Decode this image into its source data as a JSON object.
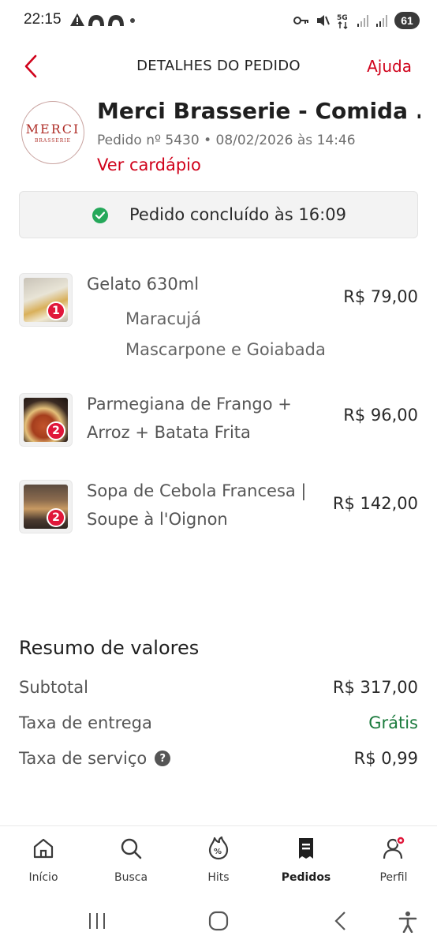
{
  "status_bar": {
    "time": "22:15",
    "battery": "61",
    "network": "5G"
  },
  "header": {
    "title": "DETALHES DO PEDIDO",
    "help": "Ajuda"
  },
  "restaurant": {
    "logo_text": "MERCI",
    "logo_subtext": "BRASSERIE",
    "name": "Merci Brasserie - Comida ...",
    "order_meta": "Pedido nº 5430 • 08/02/2026 às 14:46",
    "menu_link": "Ver cardápio"
  },
  "order_status": {
    "text": "Pedido concluído às 16:09"
  },
  "items": [
    {
      "qty": "1",
      "name": "Gelato 630ml",
      "price": "R$ 79,00",
      "options": [
        "Maracujá",
        "Mascarpone e Goiabada"
      ]
    },
    {
      "qty": "2",
      "name": "Parmegiana de Frango + Arroz + Batata Frita",
      "price": "R$ 96,00",
      "options": []
    },
    {
      "qty": "2",
      "name": "Sopa de Cebola Francesa | Soupe à l'Oignon",
      "price": "R$ 142,00",
      "options": []
    }
  ],
  "summary": {
    "title": "Resumo de valores",
    "subtotal_label": "Subtotal",
    "subtotal_value": "R$ 317,00",
    "delivery_label": "Taxa de entrega",
    "delivery_value": "Grátis",
    "service_label": "Taxa de serviço",
    "service_value": "R$ 0,99"
  },
  "bottom_nav": [
    {
      "label": "Início",
      "icon": "home-icon",
      "active": false
    },
    {
      "label": "Busca",
      "icon": "search-icon",
      "active": false
    },
    {
      "label": "Hits",
      "icon": "hits-icon",
      "active": false
    },
    {
      "label": "Pedidos",
      "icon": "orders-icon",
      "active": true
    },
    {
      "label": "Perfil",
      "icon": "profile-icon",
      "active": false
    }
  ],
  "colors": {
    "accent": "#d0021b",
    "success": "#25a85a",
    "free": "#1a7a3c",
    "badge": "#e0173a"
  }
}
